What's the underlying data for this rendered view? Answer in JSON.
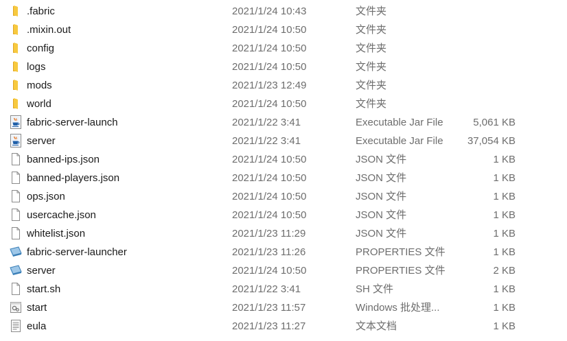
{
  "files": [
    {
      "name": ".fabric",
      "date": "2021/1/24 10:43",
      "type": "文件夹",
      "size": "",
      "icon": "folder-icon"
    },
    {
      "name": ".mixin.out",
      "date": "2021/1/24 10:50",
      "type": "文件夹",
      "size": "",
      "icon": "folder-icon"
    },
    {
      "name": "config",
      "date": "2021/1/24 10:50",
      "type": "文件夹",
      "size": "",
      "icon": "folder-icon"
    },
    {
      "name": "logs",
      "date": "2021/1/24 10:50",
      "type": "文件夹",
      "size": "",
      "icon": "folder-icon"
    },
    {
      "name": "mods",
      "date": "2021/1/23 12:49",
      "type": "文件夹",
      "size": "",
      "icon": "folder-icon"
    },
    {
      "name": "world",
      "date": "2021/1/24 10:50",
      "type": "文件夹",
      "size": "",
      "icon": "folder-icon"
    },
    {
      "name": "fabric-server-launch",
      "date": "2021/1/22 3:41",
      "type": "Executable Jar File",
      "size": "5,061 KB",
      "icon": "java-jar-icon"
    },
    {
      "name": "server",
      "date": "2021/1/22 3:41",
      "type": "Executable Jar File",
      "size": "37,054 KB",
      "icon": "java-jar-icon"
    },
    {
      "name": "banned-ips.json",
      "date": "2021/1/24 10:50",
      "type": "JSON 文件",
      "size": "1 KB",
      "icon": "blank-file-icon"
    },
    {
      "name": "banned-players.json",
      "date": "2021/1/24 10:50",
      "type": "JSON 文件",
      "size": "1 KB",
      "icon": "blank-file-icon"
    },
    {
      "name": "ops.json",
      "date": "2021/1/24 10:50",
      "type": "JSON 文件",
      "size": "1 KB",
      "icon": "blank-file-icon"
    },
    {
      "name": "usercache.json",
      "date": "2021/1/24 10:50",
      "type": "JSON 文件",
      "size": "1 KB",
      "icon": "blank-file-icon"
    },
    {
      "name": "whitelist.json",
      "date": "2021/1/23 11:29",
      "type": "JSON 文件",
      "size": "1 KB",
      "icon": "blank-file-icon"
    },
    {
      "name": "fabric-server-launcher",
      "date": "2021/1/23 11:26",
      "type": "PROPERTIES 文件",
      "size": "1 KB",
      "icon": "properties-file-icon"
    },
    {
      "name": "server",
      "date": "2021/1/24 10:50",
      "type": "PROPERTIES 文件",
      "size": "2 KB",
      "icon": "properties-file-icon"
    },
    {
      "name": "start.sh",
      "date": "2021/1/22 3:41",
      "type": "SH 文件",
      "size": "1 KB",
      "icon": "blank-file-icon"
    },
    {
      "name": "start",
      "date": "2021/1/23 11:57",
      "type": "Windows 批处理...",
      "size": "1 KB",
      "icon": "batch-file-icon"
    },
    {
      "name": "eula",
      "date": "2021/1/23 11:27",
      "type": "文本文档",
      "size": "1 KB",
      "icon": "text-document-icon"
    }
  ],
  "colors": {
    "name_text": "#1a1a1a",
    "meta_text": "#6d6d6d",
    "folder_yellow": "#f7c93f",
    "folder_dark": "#e0a420",
    "java_blue": "#1f5fa8",
    "java_orange": "#e8761e"
  }
}
